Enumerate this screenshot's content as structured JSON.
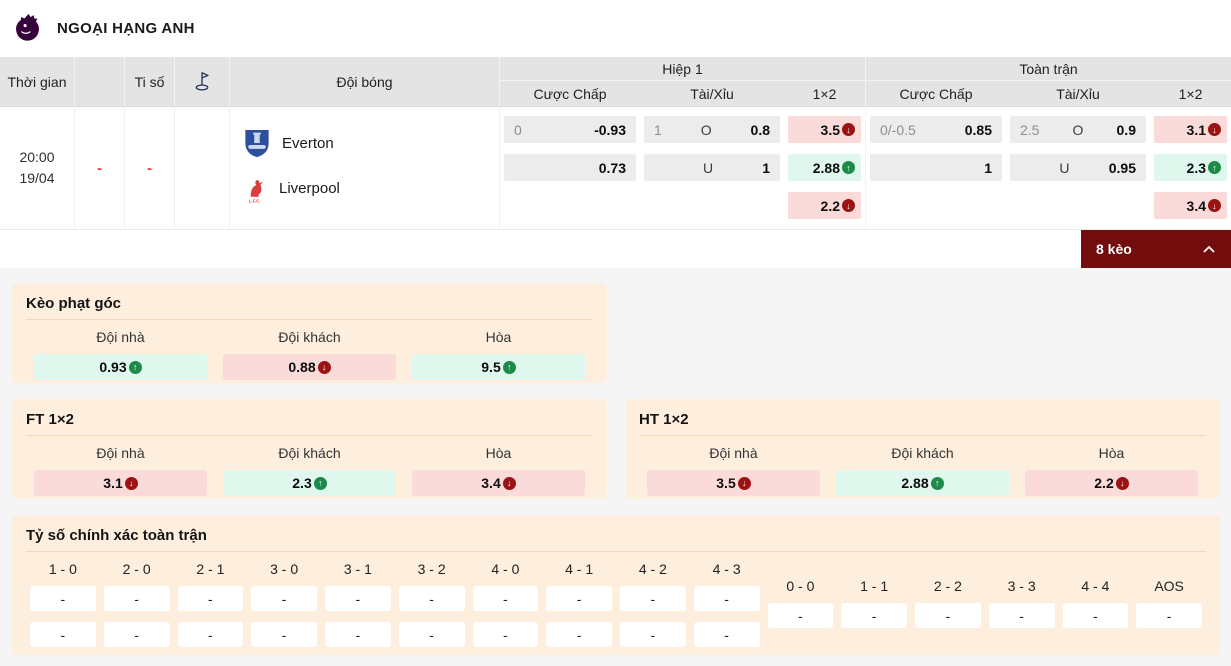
{
  "header": {
    "title": "NGOẠI HẠNG ANH"
  },
  "icons": {
    "up": "↑",
    "down": "↓"
  },
  "colors": {
    "brand_purple": "#38003c",
    "accent_maroon": "#730c0c",
    "up_green": "#1d8a4a",
    "down_red": "#9b1313",
    "mint_bg": "#dff7ec",
    "pink_bg": "#fbdada",
    "panel_peach": "#fdeede",
    "dash_red": "#f03c23"
  },
  "table": {
    "head": {
      "time": "Thời gian",
      "score": "Ti số",
      "team": "Đội bóng",
      "groups": [
        {
          "title": "Hiệp 1",
          "subs": [
            "Cược Chấp",
            "Tài/Xỉu",
            "1×2"
          ]
        },
        {
          "title": "Toàn trận",
          "subs": [
            "Cược Chấp",
            "Tài/Xỉu",
            "1×2"
          ]
        }
      ]
    },
    "match": {
      "time": "20:00",
      "date": "19/04",
      "status_dash": "-",
      "score_dash": "-",
      "home_team": "Everton",
      "away_team": "Liverpool",
      "first_half": {
        "handicap": [
          {
            "line": "0",
            "odds": "-0.93"
          },
          {
            "line": "",
            "odds": "0.73"
          }
        ],
        "over_under": [
          {
            "line": "1",
            "side": "O",
            "odds": "0.8"
          },
          {
            "line": "",
            "side": "U",
            "odds": "1"
          }
        ],
        "one_x_two": [
          {
            "odds": "3.5",
            "trend": "down"
          },
          {
            "odds": "2.88",
            "trend": "up"
          },
          {
            "odds": "2.2",
            "trend": "down"
          }
        ]
      },
      "full_time": {
        "handicap": [
          {
            "line": "0/-0.5",
            "odds": "0.85"
          },
          {
            "line": "",
            "odds": "1"
          }
        ],
        "over_under": [
          {
            "line": "2.5",
            "side": "O",
            "odds": "0.9"
          },
          {
            "line": "",
            "side": "U",
            "odds": "0.95"
          }
        ],
        "one_x_two": [
          {
            "odds": "3.1",
            "trend": "down"
          },
          {
            "odds": "2.3",
            "trend": "up"
          },
          {
            "odds": "3.4",
            "trend": "down"
          }
        ]
      }
    }
  },
  "bets_toggle": {
    "label": "8 kèo"
  },
  "panels": {
    "corner": {
      "title": "Kèo phạt góc",
      "labels": [
        "Đội nhà",
        "Đội khách",
        "Hòa"
      ],
      "values": [
        {
          "odds": "0.93",
          "trend": "up"
        },
        {
          "odds": "0.88",
          "trend": "down"
        },
        {
          "odds": "9.5",
          "trend": "up"
        }
      ]
    },
    "ft_1x2": {
      "title": "FT 1×2",
      "labels": [
        "Đội nhà",
        "Đội khách",
        "Hòa"
      ],
      "values": [
        {
          "odds": "3.1",
          "trend": "down"
        },
        {
          "odds": "2.3",
          "trend": "up"
        },
        {
          "odds": "3.4",
          "trend": "down"
        }
      ]
    },
    "ht_1x2": {
      "title": "HT 1×2",
      "labels": [
        "Đội nhà",
        "Đội khách",
        "Hòa"
      ],
      "values": [
        {
          "odds": "3.5",
          "trend": "down"
        },
        {
          "odds": "2.88",
          "trend": "up"
        },
        {
          "odds": "2.2",
          "trend": "down"
        }
      ]
    },
    "correct_score": {
      "title": "Tỷ số chính xác toàn trận",
      "group1": [
        {
          "label": "1 - 0",
          "v1": "-",
          "v2": "-"
        },
        {
          "label": "2 - 0",
          "v1": "-",
          "v2": "-"
        },
        {
          "label": "2 - 1",
          "v1": "-",
          "v2": "-"
        },
        {
          "label": "3 - 0",
          "v1": "-",
          "v2": "-"
        },
        {
          "label": "3 - 1",
          "v1": "-",
          "v2": "-"
        },
        {
          "label": "3 - 2",
          "v1": "-",
          "v2": "-"
        },
        {
          "label": "4 - 0",
          "v1": "-",
          "v2": "-"
        },
        {
          "label": "4 - 1",
          "v1": "-",
          "v2": "-"
        },
        {
          "label": "4 - 2",
          "v1": "-",
          "v2": "-"
        },
        {
          "label": "4 - 3",
          "v1": "-",
          "v2": "-"
        }
      ],
      "group2": [
        {
          "label": "0 - 0",
          "v1": "-"
        },
        {
          "label": "1 - 1",
          "v1": "-"
        },
        {
          "label": "2 - 2",
          "v1": "-"
        },
        {
          "label": "3 - 3",
          "v1": "-"
        },
        {
          "label": "4 - 4",
          "v1": "-"
        },
        {
          "label": "AOS",
          "v1": "-"
        }
      ]
    }
  }
}
